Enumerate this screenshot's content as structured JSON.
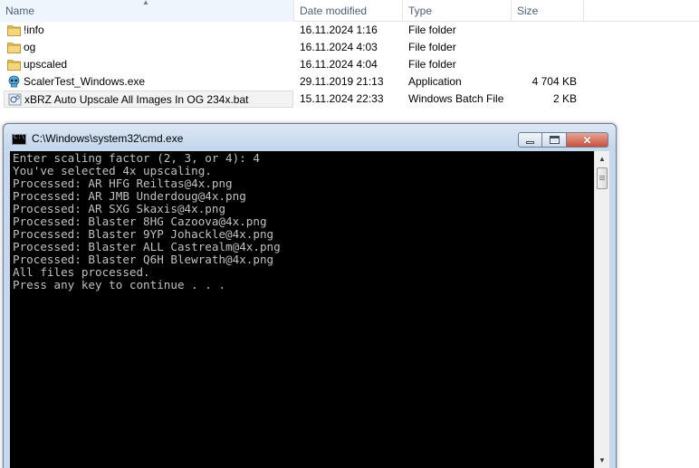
{
  "explorer": {
    "columns": {
      "name": "Name",
      "date": "Date modified",
      "type": "Type",
      "size": "Size"
    },
    "files": [
      {
        "name": "!info",
        "date": "16.11.2024 1:16",
        "type": "File folder",
        "size": "",
        "icon": "folder-icon"
      },
      {
        "name": "og",
        "date": "16.11.2024 4:03",
        "type": "File folder",
        "size": "",
        "icon": "folder-icon"
      },
      {
        "name": "upscaled",
        "date": "16.11.2024 4:04",
        "type": "File folder",
        "size": "",
        "icon": "folder-icon"
      },
      {
        "name": "ScalerTest_Windows.exe",
        "date": "29.11.2019 21:13",
        "type": "Application",
        "size": "4 704 KB",
        "icon": "skull-app-icon"
      },
      {
        "name": "xBRZ Auto Upscale All Images In OG 234x.bat",
        "date": "15.11.2024 22:33",
        "type": "Windows Batch File",
        "size": "2 KB",
        "icon": "batch-file-icon",
        "selected": true
      }
    ]
  },
  "cmd": {
    "title": "C:\\Windows\\system32\\cmd.exe",
    "lines": [
      "Enter scaling factor (2, 3, or 4): 4",
      "You've selected 4x upscaling.",
      "Processed: AR HFG Reiltas@4x.png",
      "Processed: AR JMB Underdoug@4x.png",
      "Processed: AR SXG Skaxis@4x.png",
      "Processed: Blaster 8HG Cazoova@4x.png",
      "Processed: Blaster 9YP Johackle@4x.png",
      "Processed: Blaster ALL Castrealm@4x.png",
      "Processed: Blaster Q6H Blewrath@4x.png",
      "All files processed.",
      "Press any key to continue . . ."
    ],
    "icon_text": "C:\\",
    "close_glyph": "✕"
  },
  "colors": {
    "folder": "#e8c15a",
    "console_bg": "#000000",
    "console_text": "#c0c0c0",
    "header_text": "#4c607a"
  }
}
